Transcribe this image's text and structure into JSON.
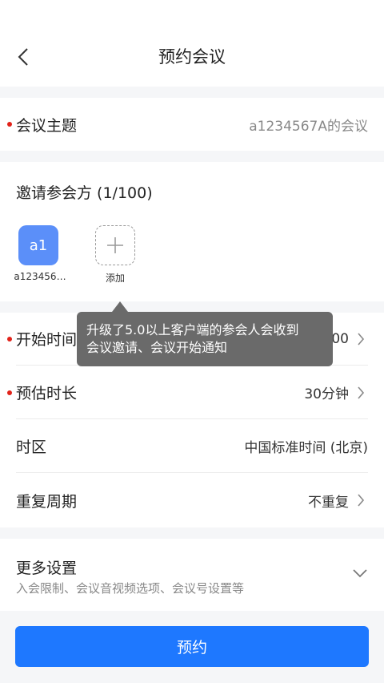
{
  "header": {
    "title": "预约会议"
  },
  "topic": {
    "label": "会议主题",
    "value": "a1234567A的会议"
  },
  "invite": {
    "title": "邀请参会方 (1/100)",
    "participants": [
      {
        "avatar_text": "a1",
        "name": "a123456…"
      }
    ],
    "add_label": "添加"
  },
  "schedule": {
    "start_label": "开始时间",
    "start_value": "00",
    "duration_label": "预估时长",
    "duration_value": "30分钟",
    "timezone_label": "时区",
    "timezone_value": "中国标准时间 (北京)",
    "repeat_label": "重复周期",
    "repeat_value": "不重复"
  },
  "more": {
    "title": "更多设置",
    "subtitle": "入会限制、会议音视频选项、会议号设置等"
  },
  "tooltip": {
    "line1": "升级了5.0以上客户端的参会人会收到",
    "line2": "会议邀请、会议开始通知"
  },
  "actions": {
    "book_label": "预约"
  },
  "colors": {
    "accent": "#1e78ff",
    "required_dot": "#e2231a",
    "avatar_bg": "#5b8ff9"
  }
}
